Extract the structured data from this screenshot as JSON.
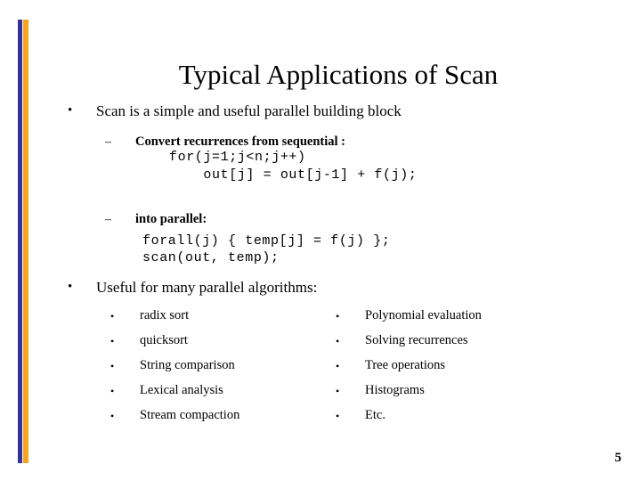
{
  "slide": {
    "title": "Typical Applications of Scan",
    "page_number": "5",
    "accent_colors": {
      "bar_blue": "#333399",
      "bar_orange": "#F4A420",
      "text": "#000000",
      "background": "#FFFFFF"
    }
  },
  "bullets": {
    "bullet_mark": "•",
    "dash_mark": "–",
    "first": {
      "text": "Scan is a simple and useful parallel building block",
      "sub": [
        {
          "label": "Convert recurrences from sequential :",
          "code": [
            "for(j=1;j<n;j++)",
            "    out[j] = out[j-1] + f(j);"
          ]
        },
        {
          "label": "into parallel:",
          "code": [
            "forall(j) { temp[j] = f(j) };",
            "scan(out, temp);"
          ]
        }
      ]
    },
    "second": {
      "text": "Useful for many parallel algorithms:",
      "columns": [
        {
          "items": [
            "radix sort",
            "quicksort",
            "String comparison",
            "Lexical analysis",
            "Stream compaction"
          ]
        },
        {
          "items": [
            "Polynomial evaluation",
            "Solving recurrences",
            "Tree operations",
            "Histograms",
            "Etc."
          ]
        }
      ]
    }
  }
}
